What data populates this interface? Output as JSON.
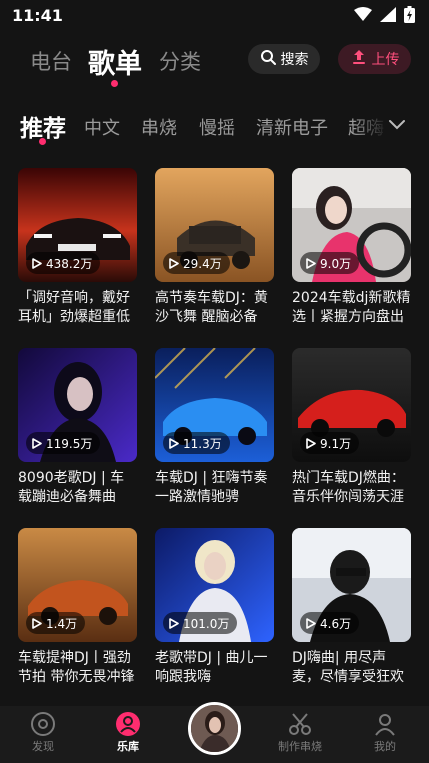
{
  "status": {
    "time": "11:41"
  },
  "top_tabs": [
    {
      "label": "电台",
      "active": false
    },
    {
      "label": "歌单",
      "active": true
    },
    {
      "label": "分类",
      "active": false
    }
  ],
  "search": {
    "label": "搜索"
  },
  "upload": {
    "label": "上传"
  },
  "categories": [
    "推荐",
    "中文",
    "串烧",
    "慢摇",
    "清新电子",
    "超嗨"
  ],
  "playlists": [
    {
      "plays": "438.2万",
      "title": "「调好音响，戴好耳机」劲爆超重低音"
    },
    {
      "plays": "29.4万",
      "title": "高节奏车载DJ：黄沙飞舞 醒脑必备"
    },
    {
      "plays": "9.0万",
      "title": "2024车载dj新歌精选丨紧握方向盘出发"
    },
    {
      "plays": "119.5万",
      "title": "8090老歌DJ | 车载蹦迪必备舞曲"
    },
    {
      "plays": "11.3万",
      "title": "车载DJ | 狂嗨节奏一路激情驰骋"
    },
    {
      "plays": "9.1万",
      "title": "热门车载DJ燃曲：音乐伴你闯荡天涯"
    },
    {
      "plays": "1.4万",
      "title": "车载提神DJ丨强劲节拍 带你无畏冲锋"
    },
    {
      "plays": "101.0万",
      "title": "老歌带DJ | 曲儿一响跟我嗨"
    },
    {
      "plays": "4.6万",
      "title": "DJ嗨曲| 用尽声麦，尽情享受狂欢"
    }
  ],
  "bottom_nav": [
    {
      "label": "发现",
      "active": false
    },
    {
      "label": "乐库",
      "active": true
    },
    {
      "label": "制作串烧",
      "active": false
    },
    {
      "label": "我的",
      "active": false
    }
  ],
  "colors": {
    "accent": "#ff2d6f",
    "background": "#141414",
    "nav_bg": "#1b1b1b"
  }
}
